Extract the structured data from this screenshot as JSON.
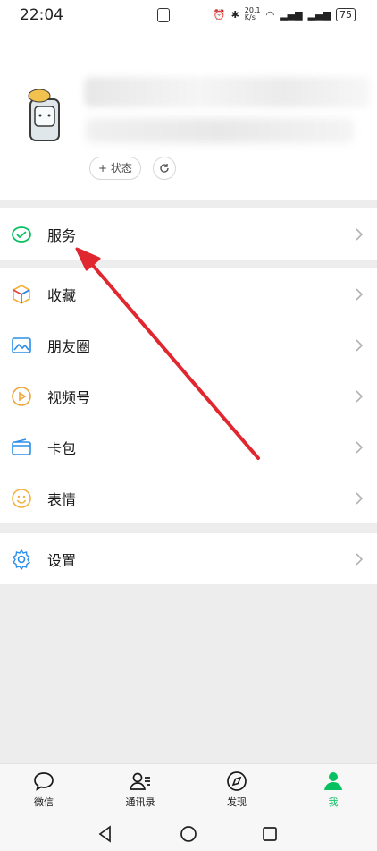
{
  "status_bar": {
    "time": "22:04",
    "net_speed_top": "20.1",
    "net_speed_bottom": "K/s",
    "battery": "75"
  },
  "profile": {
    "status_button": "+ 状态"
  },
  "menu": {
    "service": "服务",
    "favorites": "收藏",
    "moments": "朋友圈",
    "channels": "视频号",
    "cards": "卡包",
    "stickers": "表情",
    "settings": "设置"
  },
  "tabs": [
    {
      "label": "微信"
    },
    {
      "label": "通讯录"
    },
    {
      "label": "发现"
    },
    {
      "label": "我"
    }
  ],
  "colors": {
    "accent_green": "#07c160",
    "annotation_arrow": "#e0262e"
  }
}
